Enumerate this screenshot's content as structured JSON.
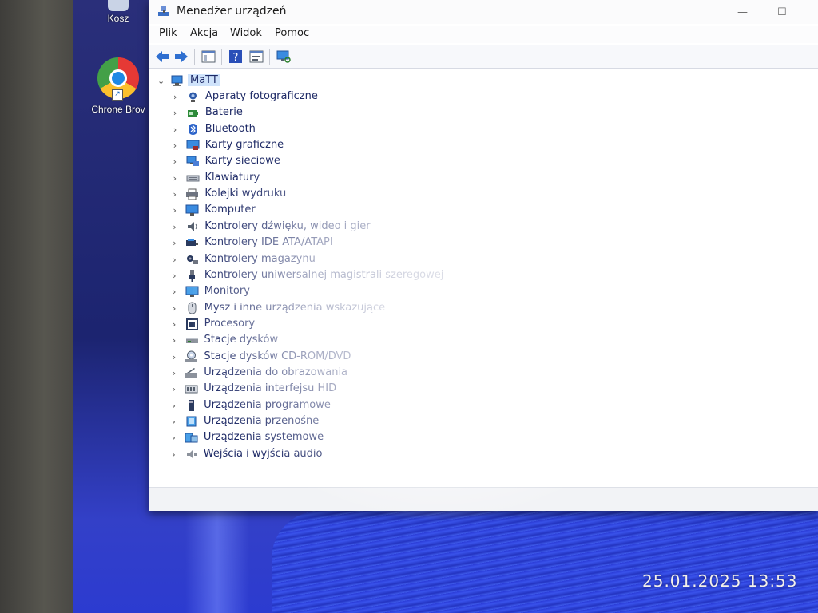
{
  "desktop": {
    "icons": [
      {
        "label": "Kosz",
        "icon": "recycle-bin-icon"
      },
      {
        "label": "Chrone Brov",
        "icon": "chrome-icon"
      }
    ],
    "timestamp": "25.01.2025  13:53"
  },
  "window": {
    "title": "Menedżer urządzeń",
    "minimize_glyph": "—",
    "maximize_glyph": "☐",
    "menu": [
      "Plik",
      "Akcja",
      "Widok",
      "Pomoc"
    ],
    "toolbar": [
      "back-arrow-icon",
      "forward-arrow-icon",
      "show-hide-console-tree-icon",
      "help-icon",
      "properties-icon",
      "scan-hardware-changes-icon"
    ],
    "tree": {
      "root": {
        "label": "MaTT",
        "icon": "computer-root-icon",
        "expanded": true
      },
      "categories": [
        {
          "label": "Aparaty fotograficzne",
          "icon": "camera-icon"
        },
        {
          "label": "Baterie",
          "icon": "battery-icon"
        },
        {
          "label": "Bluetooth",
          "icon": "bluetooth-icon"
        },
        {
          "label": "Karty graficzne",
          "icon": "display-adapter-icon"
        },
        {
          "label": "Karty sieciowe",
          "icon": "network-adapter-icon"
        },
        {
          "label": "Klawiatury",
          "icon": "keyboard-icon"
        },
        {
          "label": "Kolejki wydruku",
          "icon": "printer-icon"
        },
        {
          "label": "Komputer",
          "icon": "computer-icon"
        },
        {
          "label": "Kontrolery dźwięku, wideo i gier",
          "icon": "speaker-icon"
        },
        {
          "label": "Kontrolery IDE ATA/ATAPI",
          "icon": "ide-controller-icon"
        },
        {
          "label": "Kontrolery magazynu",
          "icon": "storage-controller-icon"
        },
        {
          "label": "Kontrolery uniwersalnej magistrali szeregowej",
          "icon": "usb-icon"
        },
        {
          "label": "Monitory",
          "icon": "monitor-icon"
        },
        {
          "label": "Mysz i inne urządzenia wskazujące",
          "icon": "mouse-icon"
        },
        {
          "label": "Procesory",
          "icon": "processor-icon"
        },
        {
          "label": "Stacje dysków",
          "icon": "disk-drive-icon"
        },
        {
          "label": "Stacje dysków CD-ROM/DVD",
          "icon": "cd-dvd-drive-icon"
        },
        {
          "label": "Urządzenia do obrazowania",
          "icon": "imaging-device-icon"
        },
        {
          "label": "Urządzenia interfejsu HID",
          "icon": "hid-icon"
        },
        {
          "label": "Urządzenia programowe",
          "icon": "software-device-icon"
        },
        {
          "label": "Urządzenia przenośne",
          "icon": "portable-device-icon"
        },
        {
          "label": "Urządzenia systemowe",
          "icon": "system-device-icon"
        },
        {
          "label": "Wejścia i wyjścia audio",
          "icon": "audio-io-icon"
        }
      ]
    }
  },
  "colors": {
    "accent": "#1e88e5",
    "selection": "#cfe3fb",
    "tree_text": "#1e2a66"
  }
}
